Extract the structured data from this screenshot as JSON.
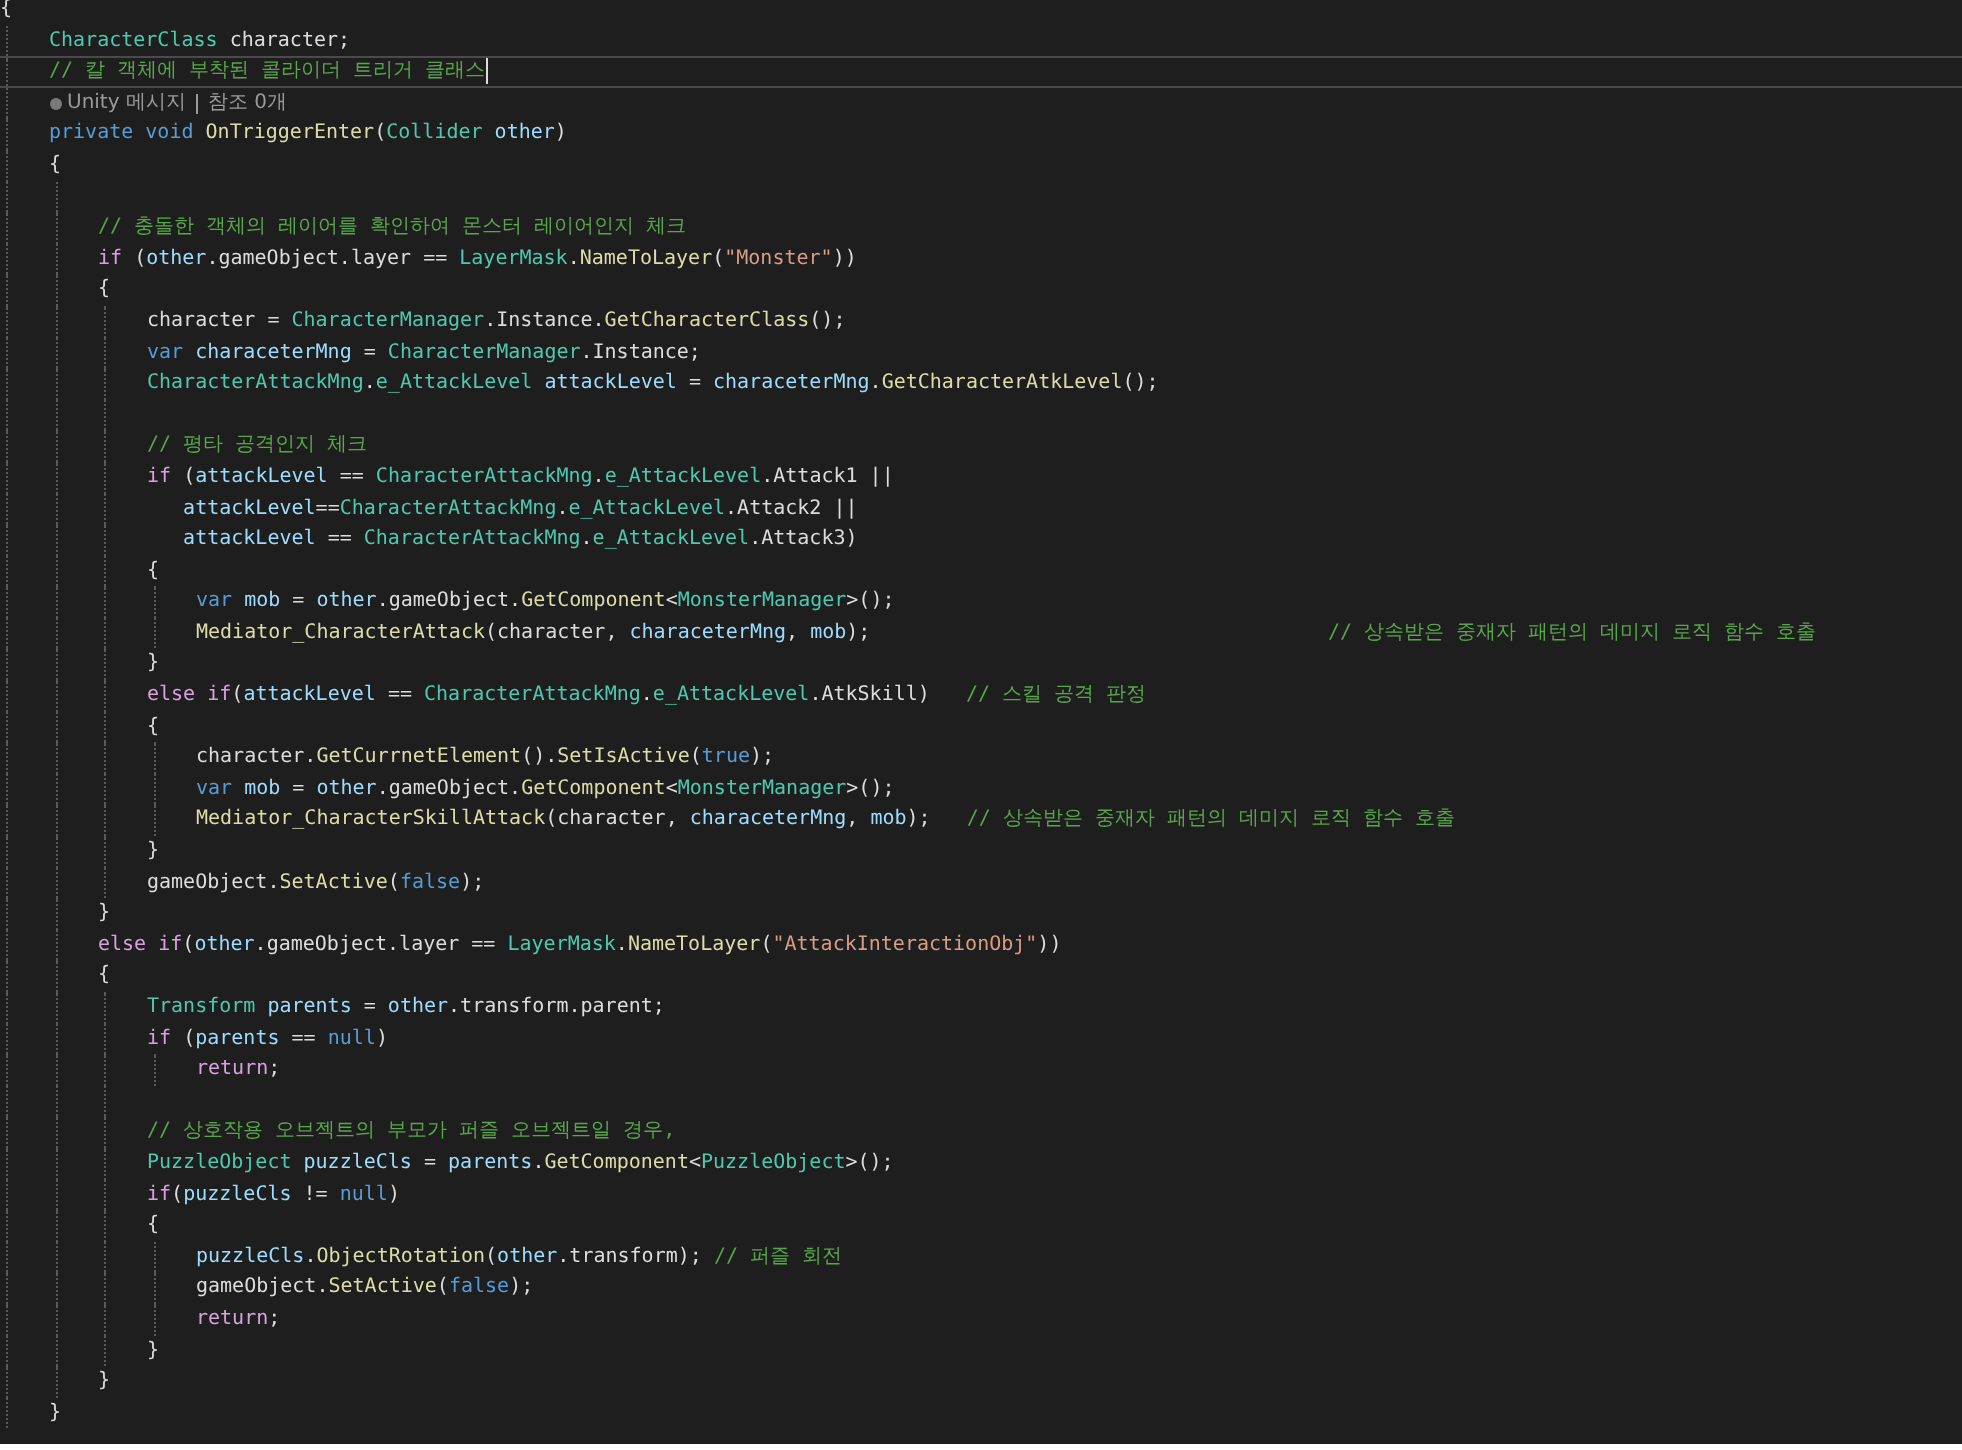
{
  "lines": [
    {
      "kind": "code",
      "current": false,
      "tokens": [
        {
          "kind": "txt",
          "text": "{"
        }
      ]
    },
    {
      "kind": "block",
      "children": [
        {
          "kind": "code",
          "current": false,
          "tokens": [
            {
              "kind": "type",
              "text": "CharacterClass"
            },
            {
              "kind": "txt",
              "text": " character;"
            }
          ]
        },
        {
          "kind": "code",
          "current": true,
          "tokens": [
            {
              "kind": "cmt",
              "text": "// 칼 객체에 부착된 콜라이더 트리거 클래스"
            }
          ]
        },
        {
          "kind": "codelens",
          "current": false,
          "links": [
            "Unity 메시지",
            "참조 0개"
          ]
        },
        {
          "kind": "code",
          "current": false,
          "tokens": [
            {
              "kind": "kw",
              "text": "private void "
            },
            {
              "kind": "fn",
              "text": "OnTriggerEnter"
            },
            {
              "kind": "txt",
              "text": "("
            },
            {
              "kind": "type",
              "text": "Collider"
            },
            {
              "kind": "var",
              "text": " other"
            },
            {
              "kind": "txt",
              "text": ")"
            }
          ]
        },
        {
          "kind": "code",
          "current": false,
          "tokens": [
            {
              "kind": "txt",
              "text": "{"
            }
          ]
        },
        {
          "kind": "block",
          "children": [
            {
              "kind": "blank",
              "current": false
            },
            {
              "kind": "code",
              "current": false,
              "tokens": [
                {
                  "kind": "cmt",
                  "text": "// 충돌한 객체의 레이어를 확인하여 몬스터 레이어인지 체크"
                }
              ]
            },
            {
              "kind": "code",
              "current": false,
              "tokens": [
                {
                  "kind": "ctl",
                  "text": "if"
                },
                {
                  "kind": "txt",
                  "text": " ("
                },
                {
                  "kind": "var",
                  "text": "other"
                },
                {
                  "kind": "txt",
                  "text": ".gameObject.layer == "
                },
                {
                  "kind": "type",
                  "text": "LayerMask"
                },
                {
                  "kind": "txt",
                  "text": "."
                },
                {
                  "kind": "fn",
                  "text": "NameToLayer"
                },
                {
                  "kind": "txt",
                  "text": "("
                },
                {
                  "kind": "str",
                  "text": "\"Monster\""
                },
                {
                  "kind": "txt",
                  "text": "))"
                }
              ]
            },
            {
              "kind": "code",
              "current": false,
              "tokens": [
                {
                  "kind": "txt",
                  "text": "{"
                }
              ]
            },
            {
              "kind": "block",
              "children": [
                {
                  "kind": "code",
                  "current": false,
                  "tokens": [
                    {
                      "kind": "txt",
                      "text": "character = "
                    },
                    {
                      "kind": "type",
                      "text": "CharacterManager"
                    },
                    {
                      "kind": "txt",
                      "text": ".Instance."
                    },
                    {
                      "kind": "fn",
                      "text": "GetCharacterClass"
                    },
                    {
                      "kind": "txt",
                      "text": "();"
                    }
                  ]
                },
                {
                  "kind": "code",
                  "current": false,
                  "tokens": [
                    {
                      "kind": "kw",
                      "text": "var"
                    },
                    {
                      "kind": "var",
                      "text": " characeterMng"
                    },
                    {
                      "kind": "txt",
                      "text": " = "
                    },
                    {
                      "kind": "type",
                      "text": "CharacterManager"
                    },
                    {
                      "kind": "txt",
                      "text": ".Instance;"
                    }
                  ]
                },
                {
                  "kind": "code",
                  "current": false,
                  "tokens": [
                    {
                      "kind": "type",
                      "text": "CharacterAttackMng"
                    },
                    {
                      "kind": "txt",
                      "text": "."
                    },
                    {
                      "kind": "type",
                      "text": "e_AttackLevel"
                    },
                    {
                      "kind": "var",
                      "text": " attackLevel"
                    },
                    {
                      "kind": "txt",
                      "text": " = "
                    },
                    {
                      "kind": "var",
                      "text": "characeterMng"
                    },
                    {
                      "kind": "txt",
                      "text": "."
                    },
                    {
                      "kind": "fn",
                      "text": "GetCharacterAtkLevel"
                    },
                    {
                      "kind": "txt",
                      "text": "();"
                    }
                  ]
                },
                {
                  "kind": "blank",
                  "current": false
                },
                {
                  "kind": "code",
                  "current": false,
                  "tokens": [
                    {
                      "kind": "cmt",
                      "text": "// 평타 공격인지 체크"
                    }
                  ]
                },
                {
                  "kind": "code",
                  "current": false,
                  "tokens": [
                    {
                      "kind": "ctl",
                      "text": "if"
                    },
                    {
                      "kind": "txt",
                      "text": " ("
                    },
                    {
                      "kind": "var",
                      "text": "attackLevel"
                    },
                    {
                      "kind": "txt",
                      "text": " == "
                    },
                    {
                      "kind": "type",
                      "text": "CharacterAttackMng"
                    },
                    {
                      "kind": "txt",
                      "text": "."
                    },
                    {
                      "kind": "type",
                      "text": "e_AttackLevel"
                    },
                    {
                      "kind": "txt",
                      "text": ".Attack1 ||"
                    }
                  ]
                },
                {
                  "kind": "code",
                  "current": false,
                  "tokens": [
                    {
                      "kind": "var",
                      "text": "   attackLevel"
                    },
                    {
                      "kind": "txt",
                      "text": "=="
                    },
                    {
                      "kind": "type",
                      "text": "CharacterAttackMng"
                    },
                    {
                      "kind": "txt",
                      "text": "."
                    },
                    {
                      "kind": "type",
                      "text": "e_AttackLevel"
                    },
                    {
                      "kind": "txt",
                      "text": ".Attack2 ||"
                    }
                  ]
                },
                {
                  "kind": "code",
                  "current": false,
                  "tokens": [
                    {
                      "kind": "var",
                      "text": "   attackLevel"
                    },
                    {
                      "kind": "txt",
                      "text": " == "
                    },
                    {
                      "kind": "type",
                      "text": "CharacterAttackMng"
                    },
                    {
                      "kind": "txt",
                      "text": "."
                    },
                    {
                      "kind": "type",
                      "text": "e_AttackLevel"
                    },
                    {
                      "kind": "txt",
                      "text": ".Attack3)"
                    }
                  ]
                },
                {
                  "kind": "code",
                  "current": false,
                  "tokens": [
                    {
                      "kind": "txt",
                      "text": "{"
                    }
                  ]
                },
                {
                  "kind": "block",
                  "children": [
                    {
                      "kind": "code",
                      "current": false,
                      "tokens": [
                        {
                          "kind": "kw",
                          "text": "var"
                        },
                        {
                          "kind": "var",
                          "text": " mob"
                        },
                        {
                          "kind": "txt",
                          "text": " = "
                        },
                        {
                          "kind": "var",
                          "text": "other"
                        },
                        {
                          "kind": "txt",
                          "text": ".gameObject."
                        },
                        {
                          "kind": "fn",
                          "text": "GetComponent"
                        },
                        {
                          "kind": "txt",
                          "text": "<"
                        },
                        {
                          "kind": "type",
                          "text": "MonsterManager"
                        },
                        {
                          "kind": "txt",
                          "text": ">();"
                        }
                      ]
                    },
                    {
                      "kind": "code",
                      "current": false,
                      "tokens": [
                        {
                          "kind": "fn",
                          "text": "Mediator_CharacterAttack"
                        },
                        {
                          "kind": "txt",
                          "text": "(character, "
                        },
                        {
                          "kind": "var",
                          "text": "characeterMng"
                        },
                        {
                          "kind": "txt",
                          "text": ", "
                        },
                        {
                          "kind": "var",
                          "text": "mob"
                        },
                        {
                          "kind": "txt",
                          "text": ");                                      "
                        },
                        {
                          "kind": "cmt",
                          "text": "// 상속받은 중재자 패턴의 데미지 로직 함수 호출"
                        }
                      ]
                    }
                  ]
                },
                {
                  "kind": "code",
                  "current": false,
                  "tokens": [
                    {
                      "kind": "txt",
                      "text": "}"
                    }
                  ]
                },
                {
                  "kind": "code",
                  "current": false,
                  "tokens": [
                    {
                      "kind": "ctl",
                      "text": "else if"
                    },
                    {
                      "kind": "txt",
                      "text": "("
                    },
                    {
                      "kind": "var",
                      "text": "attackLevel"
                    },
                    {
                      "kind": "txt",
                      "text": " == "
                    },
                    {
                      "kind": "type",
                      "text": "CharacterAttackMng"
                    },
                    {
                      "kind": "txt",
                      "text": "."
                    },
                    {
                      "kind": "type",
                      "text": "e_AttackLevel"
                    },
                    {
                      "kind": "txt",
                      "text": ".AtkSkill)   "
                    },
                    {
                      "kind": "cmt",
                      "text": "// 스킬 공격 판정"
                    }
                  ]
                },
                {
                  "kind": "code",
                  "current": false,
                  "tokens": [
                    {
                      "kind": "txt",
                      "text": "{"
                    }
                  ]
                },
                {
                  "kind": "block",
                  "children": [
                    {
                      "kind": "code",
                      "current": false,
                      "tokens": [
                        {
                          "kind": "txt",
                          "text": "character."
                        },
                        {
                          "kind": "fn",
                          "text": "GetCurrnetElement"
                        },
                        {
                          "kind": "txt",
                          "text": "()."
                        },
                        {
                          "kind": "fn",
                          "text": "SetIsActive"
                        },
                        {
                          "kind": "txt",
                          "text": "("
                        },
                        {
                          "kind": "kw",
                          "text": "true"
                        },
                        {
                          "kind": "txt",
                          "text": ");"
                        }
                      ]
                    },
                    {
                      "kind": "code",
                      "current": false,
                      "tokens": [
                        {
                          "kind": "kw",
                          "text": "var"
                        },
                        {
                          "kind": "var",
                          "text": " mob"
                        },
                        {
                          "kind": "txt",
                          "text": " = "
                        },
                        {
                          "kind": "var",
                          "text": "other"
                        },
                        {
                          "kind": "txt",
                          "text": ".gameObject."
                        },
                        {
                          "kind": "fn",
                          "text": "GetComponent"
                        },
                        {
                          "kind": "txt",
                          "text": "<"
                        },
                        {
                          "kind": "type",
                          "text": "MonsterManager"
                        },
                        {
                          "kind": "txt",
                          "text": ">();"
                        }
                      ]
                    },
                    {
                      "kind": "code",
                      "current": false,
                      "tokens": [
                        {
                          "kind": "fn",
                          "text": "Mediator_CharacterSkillAttack"
                        },
                        {
                          "kind": "txt",
                          "text": "(character, "
                        },
                        {
                          "kind": "var",
                          "text": "characeterMng"
                        },
                        {
                          "kind": "txt",
                          "text": ", "
                        },
                        {
                          "kind": "var",
                          "text": "mob"
                        },
                        {
                          "kind": "txt",
                          "text": ");   "
                        },
                        {
                          "kind": "cmt",
                          "text": "// 상속받은 중재자 패턴의 데미지 로직 함수 호출"
                        }
                      ]
                    }
                  ]
                },
                {
                  "kind": "code",
                  "current": false,
                  "tokens": [
                    {
                      "kind": "txt",
                      "text": "}"
                    }
                  ]
                },
                {
                  "kind": "code",
                  "current": false,
                  "tokens": [
                    {
                      "kind": "txt",
                      "text": "gameObject."
                    },
                    {
                      "kind": "fn",
                      "text": "SetActive"
                    },
                    {
                      "kind": "txt",
                      "text": "("
                    },
                    {
                      "kind": "kw",
                      "text": "false"
                    },
                    {
                      "kind": "txt",
                      "text": ");"
                    }
                  ]
                }
              ]
            },
            {
              "kind": "code",
              "current": false,
              "tokens": [
                {
                  "kind": "txt",
                  "text": "}"
                }
              ]
            },
            {
              "kind": "code",
              "current": false,
              "tokens": [
                {
                  "kind": "ctl",
                  "text": "else if"
                },
                {
                  "kind": "txt",
                  "text": "("
                },
                {
                  "kind": "var",
                  "text": "other"
                },
                {
                  "kind": "txt",
                  "text": ".gameObject.layer == "
                },
                {
                  "kind": "type",
                  "text": "LayerMask"
                },
                {
                  "kind": "txt",
                  "text": "."
                },
                {
                  "kind": "fn",
                  "text": "NameToLayer"
                },
                {
                  "kind": "txt",
                  "text": "("
                },
                {
                  "kind": "str",
                  "text": "\"AttackInteractionObj\""
                },
                {
                  "kind": "txt",
                  "text": "))"
                }
              ]
            },
            {
              "kind": "code",
              "current": false,
              "tokens": [
                {
                  "kind": "txt",
                  "text": "{"
                }
              ]
            },
            {
              "kind": "block",
              "children": [
                {
                  "kind": "code",
                  "current": false,
                  "tokens": [
                    {
                      "kind": "type",
                      "text": "Transform"
                    },
                    {
                      "kind": "var",
                      "text": " parents"
                    },
                    {
                      "kind": "txt",
                      "text": " = "
                    },
                    {
                      "kind": "var",
                      "text": "other"
                    },
                    {
                      "kind": "txt",
                      "text": ".transform.parent;"
                    }
                  ]
                },
                {
                  "kind": "code",
                  "current": false,
                  "tokens": [
                    {
                      "kind": "ctl",
                      "text": "if"
                    },
                    {
                      "kind": "txt",
                      "text": " ("
                    },
                    {
                      "kind": "var",
                      "text": "parents"
                    },
                    {
                      "kind": "txt",
                      "text": " == "
                    },
                    {
                      "kind": "kw",
                      "text": "null"
                    },
                    {
                      "kind": "txt",
                      "text": ")"
                    }
                  ]
                },
                {
                  "kind": "block",
                  "children": [
                    {
                      "kind": "code",
                      "current": false,
                      "tokens": [
                        {
                          "kind": "ctl",
                          "text": "return"
                        },
                        {
                          "kind": "txt",
                          "text": ";"
                        }
                      ]
                    }
                  ]
                },
                {
                  "kind": "blank",
                  "current": false
                },
                {
                  "kind": "code",
                  "current": false,
                  "tokens": [
                    {
                      "kind": "cmt",
                      "text": "// 상호작용 오브젝트의 부모가 퍼즐 오브젝트일 경우,"
                    }
                  ]
                },
                {
                  "kind": "code",
                  "current": false,
                  "tokens": [
                    {
                      "kind": "type",
                      "text": "PuzzleObject"
                    },
                    {
                      "kind": "var",
                      "text": " puzzleCls"
                    },
                    {
                      "kind": "txt",
                      "text": " = "
                    },
                    {
                      "kind": "var",
                      "text": "parents"
                    },
                    {
                      "kind": "txt",
                      "text": "."
                    },
                    {
                      "kind": "fn",
                      "text": "GetComponent"
                    },
                    {
                      "kind": "txt",
                      "text": "<"
                    },
                    {
                      "kind": "type",
                      "text": "PuzzleObject"
                    },
                    {
                      "kind": "txt",
                      "text": ">();"
                    }
                  ]
                },
                {
                  "kind": "code",
                  "current": false,
                  "tokens": [
                    {
                      "kind": "ctl",
                      "text": "if"
                    },
                    {
                      "kind": "txt",
                      "text": "("
                    },
                    {
                      "kind": "var",
                      "text": "puzzleCls"
                    },
                    {
                      "kind": "txt",
                      "text": " != "
                    },
                    {
                      "kind": "kw",
                      "text": "null"
                    },
                    {
                      "kind": "txt",
                      "text": ")"
                    }
                  ]
                },
                {
                  "kind": "code",
                  "current": false,
                  "tokens": [
                    {
                      "kind": "txt",
                      "text": "{"
                    }
                  ]
                },
                {
                  "kind": "block",
                  "children": [
                    {
                      "kind": "code",
                      "current": false,
                      "tokens": [
                        {
                          "kind": "var",
                          "text": "puzzleCls"
                        },
                        {
                          "kind": "txt",
                          "text": "."
                        },
                        {
                          "kind": "fn",
                          "text": "ObjectRotation"
                        },
                        {
                          "kind": "txt",
                          "text": "("
                        },
                        {
                          "kind": "var",
                          "text": "other"
                        },
                        {
                          "kind": "txt",
                          "text": ".transform); "
                        },
                        {
                          "kind": "cmt",
                          "text": "// 퍼즐 회전"
                        }
                      ]
                    },
                    {
                      "kind": "code",
                      "current": false,
                      "tokens": [
                        {
                          "kind": "txt",
                          "text": "gameObject."
                        },
                        {
                          "kind": "fn",
                          "text": "SetActive"
                        },
                        {
                          "kind": "txt",
                          "text": "("
                        },
                        {
                          "kind": "kw",
                          "text": "false"
                        },
                        {
                          "kind": "txt",
                          "text": ");"
                        }
                      ]
                    },
                    {
                      "kind": "code",
                      "current": false,
                      "tokens": [
                        {
                          "kind": "ctl",
                          "text": "return"
                        },
                        {
                          "kind": "txt",
                          "text": ";"
                        }
                      ]
                    }
                  ]
                },
                {
                  "kind": "code",
                  "current": false,
                  "tokens": [
                    {
                      "kind": "txt",
                      "text": "}"
                    }
                  ]
                }
              ]
            },
            {
              "kind": "code",
              "current": false,
              "tokens": [
                {
                  "kind": "txt",
                  "text": "}"
                }
              ]
            }
          ]
        },
        {
          "kind": "code",
          "current": false,
          "tokens": [
            {
              "kind": "txt",
              "text": "}"
            }
          ]
        }
      ]
    }
  ]
}
